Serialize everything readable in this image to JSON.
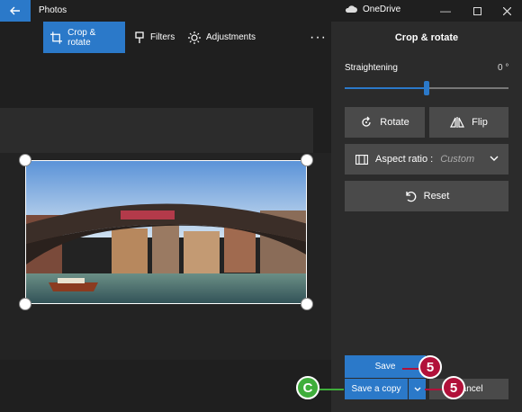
{
  "window": {
    "app_title": "Photos",
    "onedrive_label": "OneDrive",
    "controls": [
      "minimize",
      "maximize",
      "close"
    ]
  },
  "toolbar": {
    "crop_rotate": "Crop & rotate",
    "filters": "Filters",
    "adjustments": "Adjustments",
    "more": "···"
  },
  "panel": {
    "title": "Crop & rotate",
    "straightening_label": "Straightening",
    "straightening_value": "0 °",
    "straightening_level": 0.5,
    "rotate": "Rotate",
    "flip": "Flip",
    "aspect_label": "Aspect ratio : ",
    "aspect_value": "Custom",
    "reset": "Reset",
    "save": "Save",
    "save_copy": "Save a copy",
    "cancel": "Cancel"
  },
  "callouts": {
    "save_step": "5",
    "dropdown_step": "5",
    "copy_step": "C"
  },
  "colors": {
    "accent": "#2b79c9",
    "callout_red": "#b1113a",
    "callout_green": "#3fae3b"
  }
}
